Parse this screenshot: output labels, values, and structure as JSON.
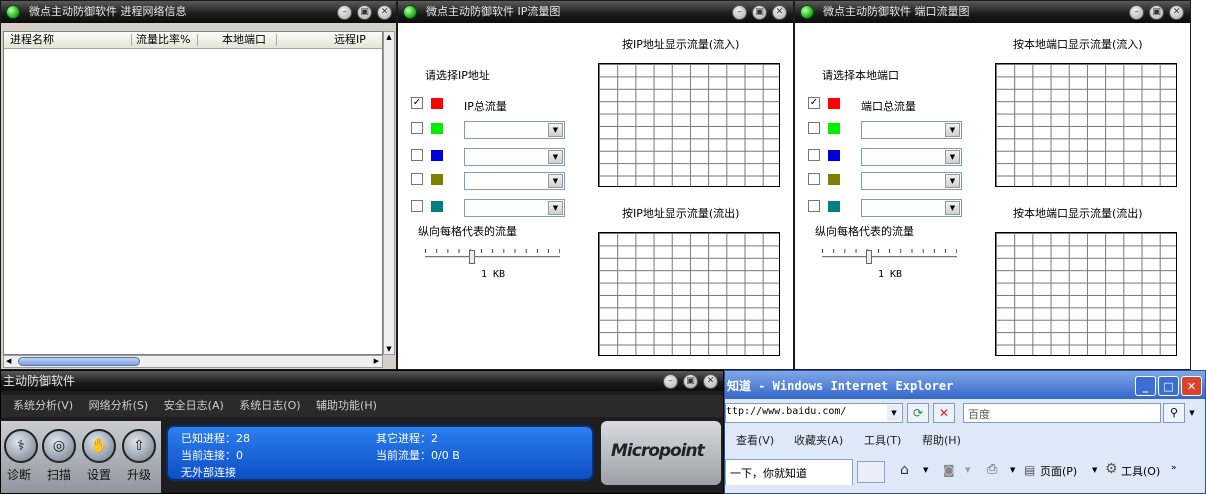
{
  "win_process": {
    "title": "微点主动防御软件 进程网络信息",
    "columns": [
      "进程名称",
      "流量比率%",
      "本地端口",
      "远程IP"
    ]
  },
  "win_ip": {
    "title": "微点主动防御软件 IP流量图",
    "select_label": "请选择IP地址",
    "total_label": "IP总流量",
    "chart_in_title": "按IP地址显示流量(流入)",
    "chart_out_title": "按IP地址显示流量(流出)",
    "scale_label": "纵向每格代表的流量",
    "scale_value": "1 KB"
  },
  "win_port": {
    "title": "微点主动防御软件 端口流量图",
    "select_label": "请选择本地端口",
    "total_label": "端口总流量",
    "chart_in_title": "按本地端口显示流量(流入)",
    "chart_out_title": "按本地端口显示流量(流出)",
    "scale_label": "纵向每格代表的流量",
    "scale_value": "1 KB"
  },
  "colors": {
    "series": [
      "#ff0000",
      "#00ee00",
      "#0000dd",
      "#808000",
      "#008080"
    ],
    "accent_blue": "#1464d8",
    "title_bar": "#1a1a1a"
  },
  "main": {
    "title": "主动防御软件",
    "menu": [
      "系统分析(V)",
      "网络分析(S)",
      "安全日志(A)",
      "系统日志(O)",
      "辅助功能(H)"
    ],
    "tools": [
      {
        "label": "诊断",
        "icon": "diagnose-icon"
      },
      {
        "label": "扫描",
        "icon": "scan-icon"
      },
      {
        "label": "设置",
        "icon": "settings-hand-icon"
      },
      {
        "label": "升级",
        "icon": "upgrade-icon"
      }
    ],
    "status": {
      "known": "已知进程：28",
      "other": "其它进程：2",
      "conn": "当前连接：0",
      "flow": "当前流量：0/0 B",
      "external": "无外部连接"
    },
    "logo": "Micropoint"
  },
  "ie": {
    "title": "知道 - Windows Internet Explorer",
    "address": "ttp://www.baidu.com/",
    "search_placeholder": "百度",
    "menu": [
      "查看(V)",
      "收藏夹(A)",
      "工具(T)",
      "帮助(H)"
    ],
    "tab": "一下，你就知道",
    "page_label": "页面(P)",
    "tools_label": "工具(O)"
  }
}
